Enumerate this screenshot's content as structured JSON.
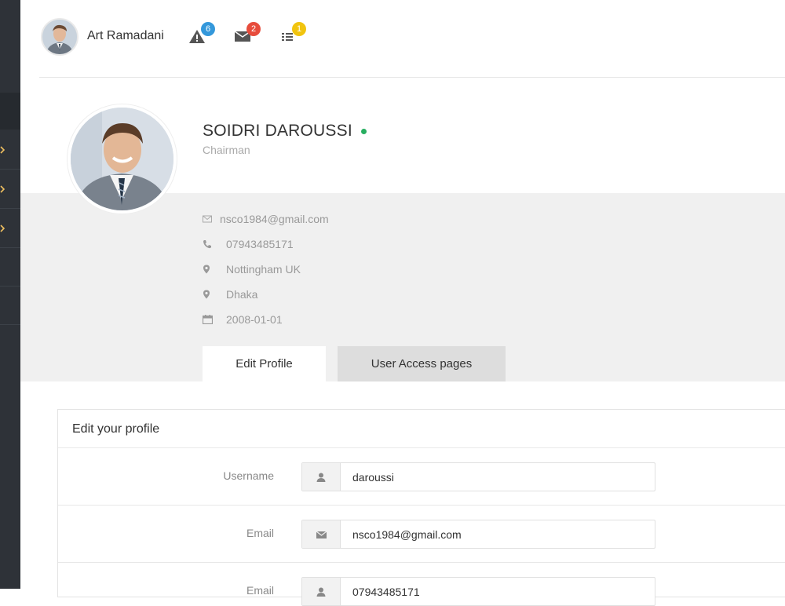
{
  "topbar": {
    "user_name": "Art Ramadani",
    "notifications": [
      {
        "icon": "warning-icon",
        "count": "6",
        "color": "#3498db"
      },
      {
        "icon": "envelope-icon",
        "count": "2",
        "color": "#e74c3c"
      },
      {
        "icon": "list-icon",
        "count": "1",
        "color": "#f1c40f"
      }
    ]
  },
  "profile": {
    "name": "SOIDRI DAROUSSI",
    "role": "Chairman",
    "status_color": "#27ae60",
    "info": [
      {
        "icon": "envelope-icon",
        "text": "nsco1984@gmail.com"
      },
      {
        "icon": "phone-icon",
        "text": "07943485171"
      },
      {
        "icon": "map-marker-icon",
        "text": "Nottingham UK"
      },
      {
        "icon": "map-marker-icon",
        "text": "Dhaka"
      },
      {
        "icon": "calendar-icon",
        "text": "2008-01-01"
      }
    ]
  },
  "tabs": [
    {
      "label": "Edit Profile",
      "active": true
    },
    {
      "label": "User Access pages",
      "active": false
    }
  ],
  "form": {
    "title": "Edit your profile",
    "fields": [
      {
        "label": "Username",
        "icon": "user-icon",
        "value": "daroussi"
      },
      {
        "label": "Email",
        "icon": "envelope-icon",
        "value": "nsco1984@gmail.com"
      },
      {
        "label": "Email",
        "icon": "user-icon",
        "value": "07943485171"
      }
    ]
  }
}
